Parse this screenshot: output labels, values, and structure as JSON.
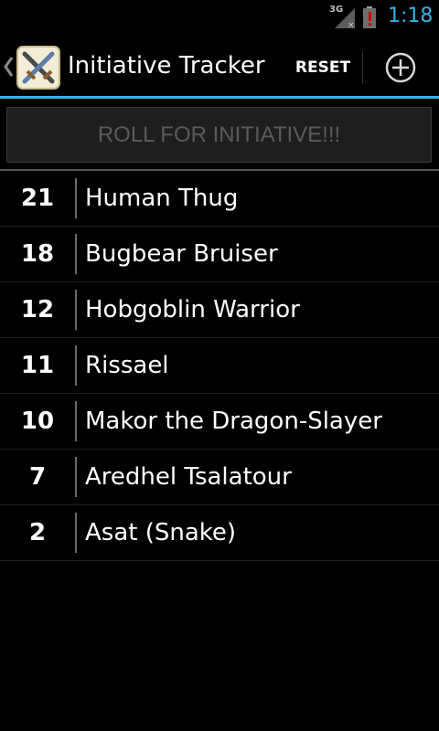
{
  "status_bar": {
    "network": "3G",
    "time": "1:18",
    "icons": [
      "signal-icon",
      "battery-alert-icon"
    ]
  },
  "action_bar": {
    "title": "Initiative Tracker",
    "reset_label": "RESET",
    "icons": [
      "up-caret-icon",
      "crossed-swords-icon",
      "add-circle-icon"
    ]
  },
  "roll_button": {
    "label": "ROLL FOR INITIATIVE!!!"
  },
  "combatants": [
    {
      "initiative": "21",
      "name": "Human Thug"
    },
    {
      "initiative": "18",
      "name": "Bugbear Bruiser"
    },
    {
      "initiative": "12",
      "name": "Hobgoblin Warrior"
    },
    {
      "initiative": "11",
      "name": "Rissael"
    },
    {
      "initiative": "10",
      "name": "Makor the Dragon-Slayer"
    },
    {
      "initiative": "7",
      "name": "Aredhel Tsalatour"
    },
    {
      "initiative": "2",
      "name": "Asat (Snake)"
    }
  ],
  "colors": {
    "accent": "#33b5e5",
    "background": "#000000",
    "disabled_text": "#5a5a5a",
    "battery_alert": "#cc0000"
  }
}
